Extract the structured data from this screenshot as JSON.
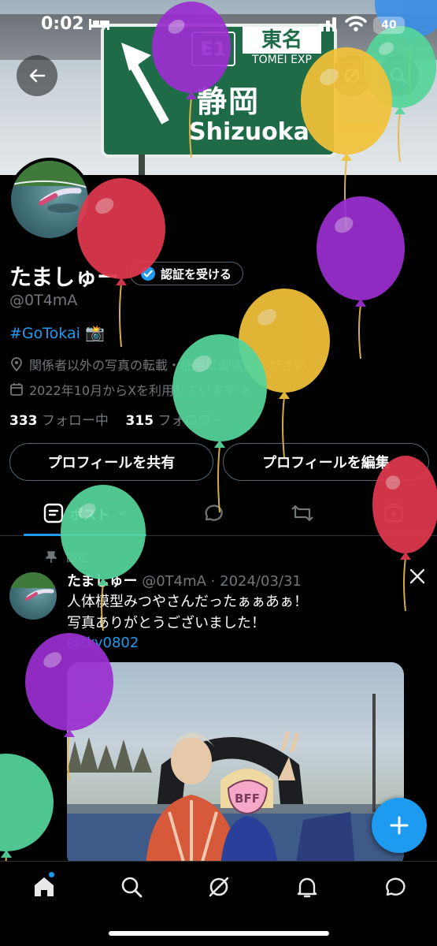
{
  "status_bar": {
    "time": "0:02",
    "battery": "40"
  },
  "banner": {
    "sign_badge": "E1",
    "sign_title_jp": "東名",
    "sign_title_en": "TOMEI EXP",
    "sign_city_jp": "静岡",
    "sign_city_en": "Shizuoka"
  },
  "profile": {
    "display_name": "たましゅー",
    "verify_label": "認証を受ける",
    "handle": "@0T4mA",
    "bio_tag": "#GoTokai",
    "bio_emoji": "📸",
    "location": "関係者以外の写真の転載・使用は御遠慮ください",
    "joined": "2022年10月からXを利用しています",
    "following_count": "333",
    "following_label": "フォロー中",
    "followers_count": "315",
    "followers_label": "フォロワー",
    "share_label": "プロフィールを共有",
    "edit_label": "プロフィールを編集"
  },
  "tabs": {
    "posts_label": "ポスト"
  },
  "post": {
    "pinned_label": "固定",
    "author": "たましゅー",
    "meta": "@0T4mA · 2024/03/31",
    "text_line1": "人体模型みつやさんだったぁぁあぁ！",
    "text_line2": "写真ありがとうございました！",
    "mention": "@tky0802",
    "image_sticker": "BFF"
  },
  "colors": {
    "accent": "#1d9bf0",
    "balloon_red": "#e0394f",
    "balloon_purple": "#9b2fd0",
    "balloon_yellow": "#f2c23a",
    "balloon_green": "#56d49a",
    "balloon_blue": "#3d8fe6"
  }
}
